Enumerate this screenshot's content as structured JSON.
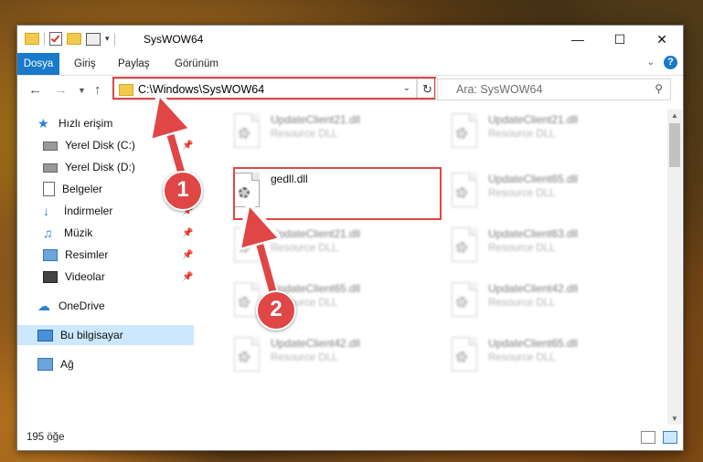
{
  "window": {
    "title": "SysWOW64"
  },
  "ribbon": {
    "tabs": [
      "Dosya",
      "Giriş",
      "Paylaş",
      "Görünüm"
    ],
    "help": "?"
  },
  "nav": {
    "address": "C:\\Windows\\SysWOW64",
    "search_placeholder": "Ara: SysWOW64"
  },
  "sidebar": {
    "items": [
      {
        "label": "Hızlı erişim",
        "icon": "star-icon"
      },
      {
        "label": "Yerel Disk (C:)",
        "icon": "drive-icon"
      },
      {
        "label": "Yerel Disk (D:)",
        "icon": "drive-icon"
      },
      {
        "label": "Belgeler",
        "icon": "documents-icon"
      },
      {
        "label": "İndirmeler",
        "icon": "download-icon"
      },
      {
        "label": "Müzik",
        "icon": "music-icon"
      },
      {
        "label": "Resimler",
        "icon": "pictures-icon"
      },
      {
        "label": "Videolar",
        "icon": "videos-icon"
      },
      {
        "label": "OneDrive",
        "icon": "cloud-icon"
      },
      {
        "label": "Bu bilgisayar",
        "icon": "computer-icon"
      },
      {
        "label": "Ağ",
        "icon": "network-icon"
      }
    ]
  },
  "files": [
    {
      "name": "UpdateClient21.dll",
      "desc": "Resource DLL"
    },
    {
      "name": "UpdateClient21.dll",
      "desc": "Resource DLL"
    },
    {
      "name": "gedll.dll",
      "desc": ""
    },
    {
      "name": "UpdateClient65.dll",
      "desc": "Resource DLL"
    },
    {
      "name": "UpdateClient21.dll",
      "desc": "Resource DLL"
    },
    {
      "name": "UpdateClient63.dll",
      "desc": "Resource DLL"
    },
    {
      "name": "UpdateClient65.dll",
      "desc": "Resource DLL"
    },
    {
      "name": "UpdateClient42.dll",
      "desc": "Resource DLL"
    },
    {
      "name": "UpdateClient42.dll",
      "desc": "Resource DLL"
    },
    {
      "name": "UpdateClient65.dll",
      "desc": "Resource DLL"
    }
  ],
  "status": {
    "count": "195 öğe"
  },
  "annotations": {
    "step1": "1",
    "step2": "2"
  },
  "colors": {
    "accent": "#1979ca",
    "highlight": "#e04646"
  }
}
